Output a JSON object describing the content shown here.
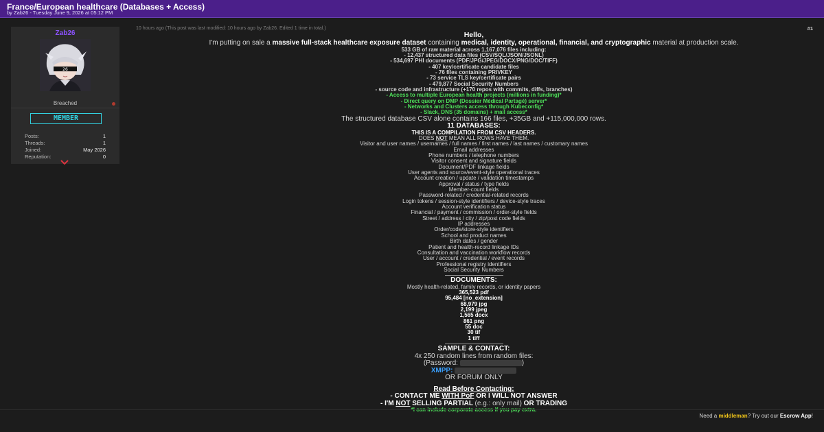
{
  "header": {
    "title": "France/European healthcare (Databases + Access)",
    "byline": "by Zab26 - Tuesday June 9, 2026 at 05:12 PM"
  },
  "author": {
    "name": "Zab26",
    "group": "Breached",
    "rank_badge": "MEMBER",
    "stats": [
      {
        "label": "Posts:",
        "value": "1"
      },
      {
        "label": "Threads:",
        "value": "1"
      },
      {
        "label": "Joined:",
        "value": "May 2026"
      },
      {
        "label": "Reputation:",
        "value": "0"
      }
    ],
    "avatar_tag": "26"
  },
  "post": {
    "meta": "10 hours ago  (This post was last modified: 10 hours ago by Zab26. Edited 1 time in total.)",
    "number": "#1",
    "hello": "Hello,",
    "intro_a": "I'm putting on sale a ",
    "intro_b": "massive full-stack healthcare exposure dataset",
    "intro_c": " containing ",
    "intro_d": "medical, identity, operational, financial, and cryptographic",
    "intro_e": " material at production scale.",
    "summary": [
      "533 GB of raw material across 1,167,076 files including:",
      "- 12,437 structured data files (CSV/SQL/JSON/JSONL)",
      "- 534,697 PHI documents (PDF/JPG/JPEG/DOCX/PNG/DOC/TIFF)",
      "- 407 key/certificate candidate files",
      "- 76 files containing PRIVKEY",
      "- 73 service TLS key/certificate pairs",
      "- 479,877 Social Security Numbers",
      "- source code and infrastructure (+170 repos with commits, diffs, branches)"
    ],
    "access": [
      "- Access to multiple European health projects (millions in funding)*",
      "- Direct query on DMP (Dossier Médical Partagé) server*",
      "- Networks and Clusters access through Kubeconfig*",
      "- Slack, DNS (35 domains) + mail access*"
    ],
    "csv_note": "The structured database CSV alone contains 166 files, +35GB and +115,000,000 rows.",
    "db_heading": "11 DATABASES:",
    "compilation": "THIS IS A COMPILATION FROM CSV HEADERS.",
    "does_a": "DOES ",
    "does_b": "NOT",
    "does_c": " MEAN ALL ROWS HAVE THEM.",
    "fields": [
      "Visitor and user names / usernames / full names / first names / last names / customary names",
      "Email addresses",
      "Phone numbers / telephone numbers",
      "Visitor consent and signature fields",
      "Document/PDF linkage fields",
      "User agents and source/event-style operational traces",
      "Account creation / update / validation timestamps",
      "Approval / status / type fields",
      "Member-count fields",
      "Password-related / credential-related records",
      "Login tokens / session-style identifiers / device-style traces",
      "Account verification status",
      "Financial / payment / commission / order-style fields",
      "Street / address / city / zip/post code fields",
      "IP addresses",
      "Order/code/store-style identifiers",
      "School and product names",
      "Birth dates / gender",
      "Patient and health-record linkage IDs",
      "Consultation and vaccination workflow records",
      "User / account / credential / event records",
      "Professional registry identifiers",
      "Social Security Numbers"
    ],
    "docs_heading": "DOCUMENTS:",
    "docs_note": "Mostly health-related, family records, or identity papers",
    "docs": [
      "365,523 pdf",
      "95,484 [no_extension]",
      "68,979 jpg",
      "2,199 jpeg",
      "1,565 docx",
      "861 png",
      "55 doc",
      "30 tif",
      "1 tiff"
    ],
    "sample_heading": "SAMPLE & CONTACT:",
    "sample_line": "4x 250 random lines from random files:",
    "password_label": "(Password: ",
    "password_close": ")",
    "xmpp_label": "XMPP:",
    "forum_only": "OR FORUM ONLY",
    "read_heading": "Read Before Contacting:",
    "rule1_a": "- CONTACT ME ",
    "rule1_b": "WITH PoF",
    "rule1_c": " OR I WILL NOT ANSWER",
    "rule2_a": "- I'M ",
    "rule2_b": "NOT",
    "rule2_c": " SELLING PARTIAL ",
    "rule2_d": "(e.g.: only mail)",
    "rule2_e": " OR TRADING",
    "rule3": "*I can include corporate access if you pay extra."
  },
  "footer": {
    "escrow_a": "Need a ",
    "escrow_b": "middleman",
    "escrow_c": "? Try out our ",
    "escrow_d": "Escrow App",
    "escrow_e": "!"
  },
  "colors": {
    "header_bg": "#4b1f8a",
    "username": "#8c52ff",
    "badge": "#32d1e0",
    "highlight_green": "#4ee05a",
    "xmpp_blue": "#3aa0ff",
    "escrow_yellow": "#f0c419"
  }
}
